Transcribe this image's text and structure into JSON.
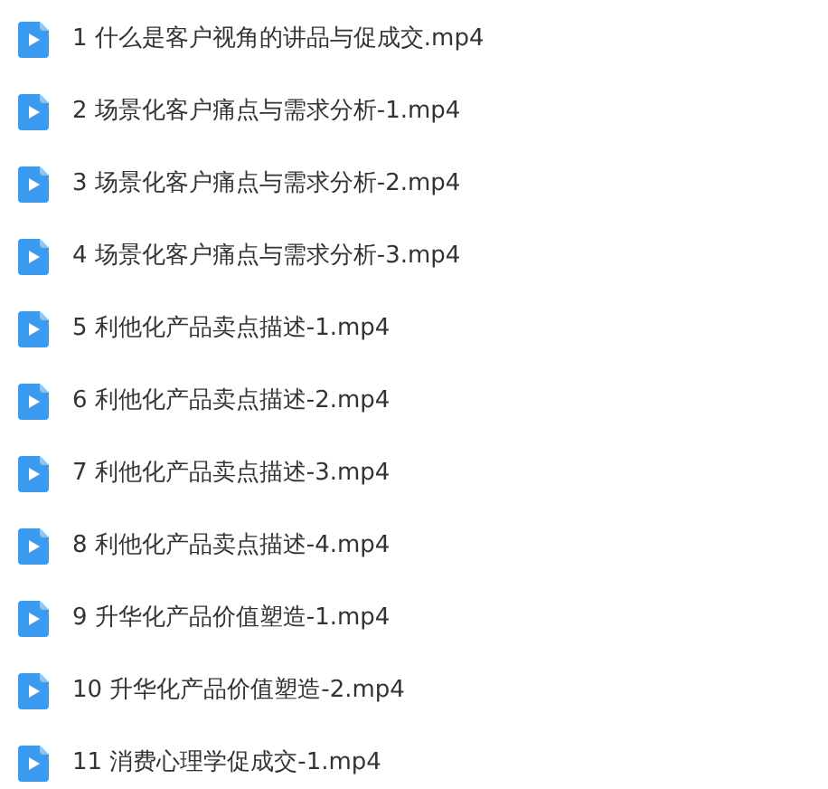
{
  "files": [
    {
      "name": "1 什么是客户视角的讲品与促成交.mp4"
    },
    {
      "name": "2 场景化客户痛点与需求分析-1.mp4"
    },
    {
      "name": "3 场景化客户痛点与需求分析-2.mp4"
    },
    {
      "name": "4 场景化客户痛点与需求分析-3.mp4"
    },
    {
      "name": "5 利他化产品卖点描述-1.mp4"
    },
    {
      "name": "6 利他化产品卖点描述-2.mp4"
    },
    {
      "name": "7 利他化产品卖点描述-3.mp4"
    },
    {
      "name": "8 利他化产品卖点描述-4.mp4"
    },
    {
      "name": "9 升华化产品价值塑造-1.mp4"
    },
    {
      "name": "10 升华化产品价值塑造-2.mp4"
    },
    {
      "name": "11 消费心理学促成交-1.mp4"
    }
  ]
}
